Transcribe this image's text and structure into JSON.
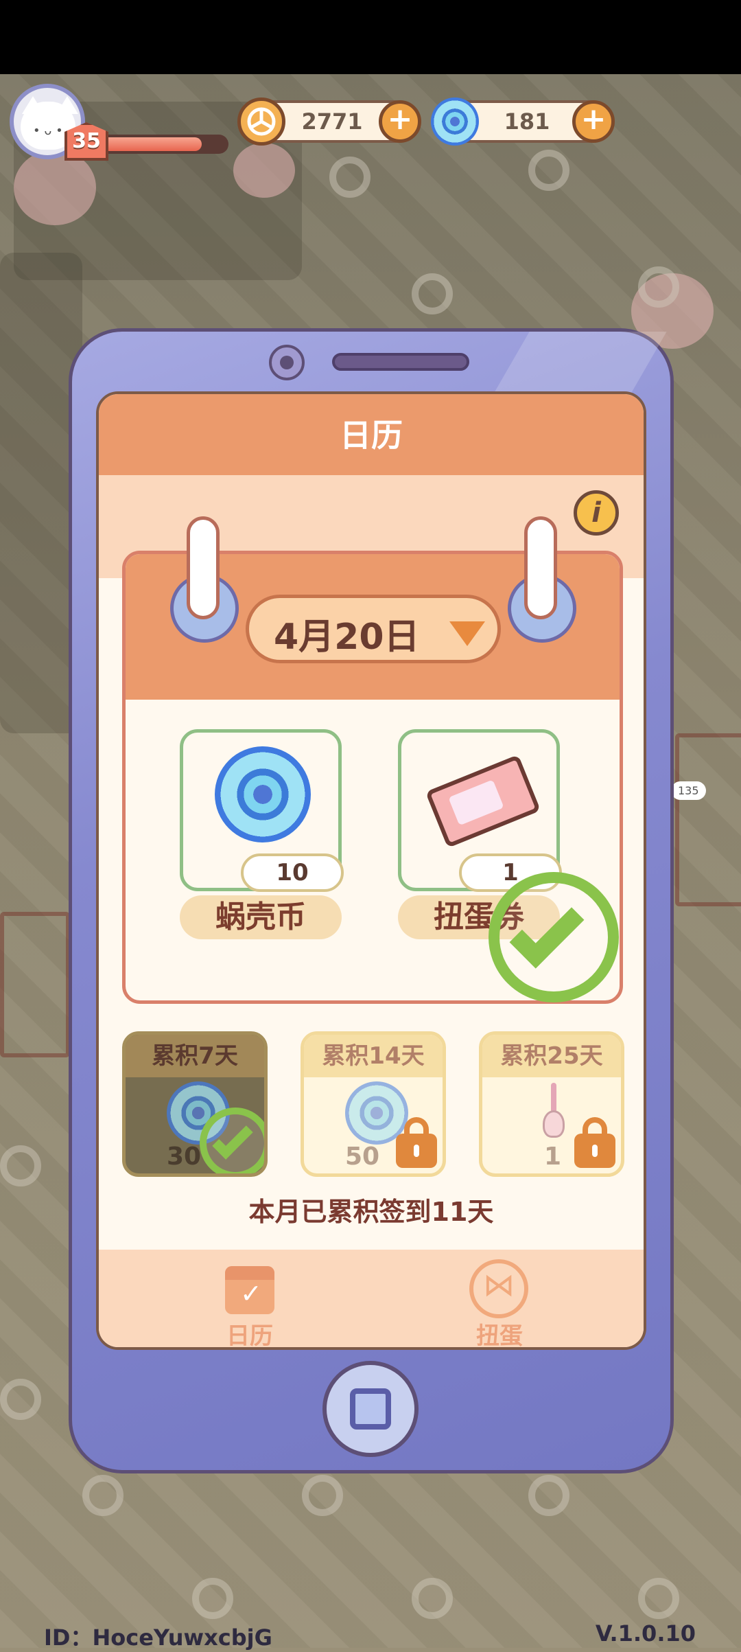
{
  "hud": {
    "level": "35",
    "level_progress": 0.82,
    "coins": "2771",
    "snail_coins": "181"
  },
  "calendar": {
    "title": "日历",
    "date": "4月20日",
    "rewards": [
      {
        "name": "蜗壳币",
        "count": "10",
        "icon": "snail-coin-icon"
      },
      {
        "name": "扭蛋券",
        "count": "1",
        "icon": "gacha-ticket-icon",
        "claimed": true
      }
    ],
    "milestones": [
      {
        "label": "累积7天",
        "amount": "30",
        "state": "claimed"
      },
      {
        "label": "累积14天",
        "amount": "50",
        "state": "locked"
      },
      {
        "label": "累积25天",
        "amount": "1",
        "state": "locked"
      }
    ],
    "summary": "本月已累积签到11天"
  },
  "tabs": [
    {
      "label": "日历",
      "icon": "calendar-icon"
    },
    {
      "label": "扭蛋",
      "icon": "gacha-icon"
    }
  ],
  "bg_sign": "135",
  "footer": {
    "id": "ID：HoceYuwxcbjG",
    "version": "V.1.0.10"
  },
  "colors": {
    "header_orange": "#eb9a6c",
    "check_green": "#8ac34b",
    "phone_purple": "#8689cf"
  }
}
